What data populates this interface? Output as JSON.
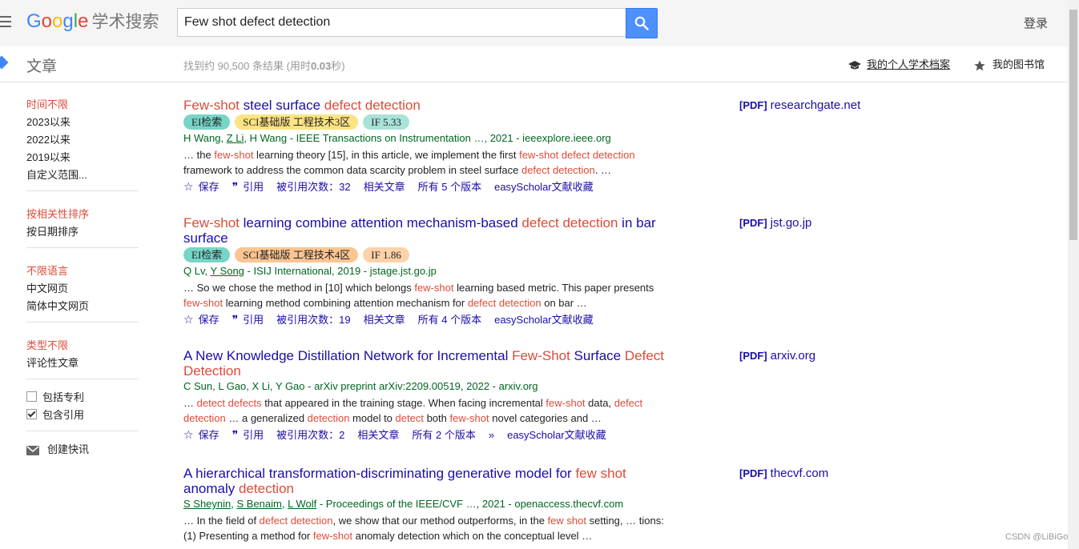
{
  "header": {
    "logo_google": [
      "G",
      "o",
      "o",
      "g",
      "l",
      "e"
    ],
    "logo_sub": "学术搜索",
    "search_value": "Few shot defect detection",
    "login": "登录"
  },
  "subheader": {
    "section": "文章",
    "stats_prefix": "找到约 90,500 条结果  (用时",
    "stats_time": "0.03",
    "stats_suffix": "秒)",
    "my_profile": "我的个人学术档案",
    "my_library": "我的图书馆"
  },
  "sidebar": {
    "time": [
      "时间不限",
      "2023以来",
      "2022以来",
      "2019以来",
      "自定义范围..."
    ],
    "sort": [
      "按相关性排序",
      "按日期排序"
    ],
    "lang": [
      "不限语言",
      "中文网页",
      "简体中文网页"
    ],
    "type": [
      "类型不限",
      "评论性文章"
    ],
    "include_patents": "包括专利",
    "include_citations": "包含引用",
    "create_alert": "创建快讯"
  },
  "results": [
    {
      "title": [
        [
          "Few-shot",
          true
        ],
        [
          " steel surface ",
          false
        ],
        [
          "defect detection",
          true
        ]
      ],
      "badges": [
        [
          "EI检索",
          "ei"
        ],
        [
          "SCI基础版 工程技术3区",
          "sci-yellow"
        ],
        [
          "IF 5.33",
          "if-teal"
        ]
      ],
      "authors": [
        [
          "H Wang",
          false
        ],
        [
          ", ",
          false
        ],
        [
          "Z Li",
          true
        ],
        [
          ", H Wang - IEEE Transactions on Instrumentation …, 2021 - ieeexplore.ieee.org",
          false
        ]
      ],
      "snippet": [
        [
          "… the ",
          false
        ],
        [
          "few-shot",
          true
        ],
        [
          " learning theory [15], in this article, we implement the first ",
          false
        ],
        [
          "few-shot defect detection",
          true
        ],
        [
          " framework to address the common data scarcity problem in steel surface ",
          false
        ],
        [
          "defect detection",
          true
        ],
        [
          ". …",
          false
        ]
      ],
      "save": "保存",
      "cite": "引用",
      "cited_by": "被引用次数：32",
      "related": "相关文章",
      "versions": "所有 5 个版本",
      "easyscholar": "easyScholar文献收藏",
      "pdf_tag": "[PDF]",
      "pdf_source": "researchgate.net"
    },
    {
      "title": [
        [
          "Few-shot",
          true
        ],
        [
          " learning combine attention mechanism-based ",
          false
        ],
        [
          "defect detection",
          true
        ],
        [
          " in bar surface",
          false
        ]
      ],
      "badges": [
        [
          "EI检索",
          "ei"
        ],
        [
          "SCI基础版 工程技术4区",
          "sci-orange"
        ],
        [
          "IF 1.86",
          "if-orange"
        ]
      ],
      "authors": [
        [
          "Q Lv",
          false
        ],
        [
          ", ",
          false
        ],
        [
          "Y Song",
          true
        ],
        [
          " - ISIJ International, 2019 - jstage.jst.go.jp",
          false
        ]
      ],
      "snippet": [
        [
          "… So we chose the method in [10] which belongs ",
          false
        ],
        [
          "few-shot",
          true
        ],
        [
          " learning based metric. This paper presents ",
          false
        ],
        [
          "few-shot",
          true
        ],
        [
          " learning method combining attention mechanism for ",
          false
        ],
        [
          "defect detection",
          true
        ],
        [
          " on bar …",
          false
        ]
      ],
      "save": "保存",
      "cite": "引用",
      "cited_by": "被引用次数：19",
      "related": "相关文章",
      "versions": "所有 4 个版本",
      "easyscholar": "easyScholar文献收藏",
      "pdf_tag": "[PDF]",
      "pdf_source": "jst.go.jp"
    },
    {
      "title": [
        [
          "A New Knowledge Distillation Network for Incremental ",
          false
        ],
        [
          "Few-Shot",
          true
        ],
        [
          " Surface ",
          false
        ],
        [
          "Defect Detection",
          true
        ]
      ],
      "badges": [],
      "authors": [
        [
          "C Sun, L Gao, X Li, Y Gao - arXiv preprint arXiv:2209.00519, 2022 - arxiv.org",
          false
        ]
      ],
      "snippet": [
        [
          "… ",
          false
        ],
        [
          "detect defects",
          true
        ],
        [
          " that appeared in the training stage. When facing incremental ",
          false
        ],
        [
          "few-shot",
          true
        ],
        [
          " data, ",
          false
        ],
        [
          "defect detection",
          true
        ],
        [
          " … a generalized ",
          false
        ],
        [
          "detection",
          true
        ],
        [
          " model to ",
          false
        ],
        [
          "detect",
          true
        ],
        [
          " both ",
          false
        ],
        [
          "few-shot",
          true
        ],
        [
          " novel categories and …",
          false
        ]
      ],
      "save": "保存",
      "cite": "引用",
      "cited_by": "被引用次数：2",
      "related": "相关文章",
      "versions": "所有 2 个版本",
      "easyscholar": "easyScholar文献收藏",
      "pdf_tag": "[PDF]",
      "pdf_source": "arxiv.org"
    },
    {
      "title": [
        [
          "A hierarchical transformation-discriminating generative model for ",
          false
        ],
        [
          "few shot",
          true
        ],
        [
          " anomaly ",
          false
        ],
        [
          "detection",
          true
        ]
      ],
      "badges": [],
      "authors": [
        [
          "S Sheynin",
          true
        ],
        [
          ", ",
          false
        ],
        [
          "S Benaim",
          true
        ],
        [
          ", ",
          false
        ],
        [
          "L Wolf",
          true
        ],
        [
          " - Proceedings of the IEEE/CVF …, 2021 - openaccess.thecvf.com",
          false
        ]
      ],
      "snippet": [
        [
          "… In the field of ",
          false
        ],
        [
          "defect detection",
          true
        ],
        [
          ", we show that our method outperforms, in the ",
          false
        ],
        [
          "few shot",
          true
        ],
        [
          " setting, … tions: (1) Presenting a method for ",
          false
        ],
        [
          "few-shot",
          true
        ],
        [
          " anomaly detection which on the conceptual level …",
          false
        ]
      ],
      "save": "",
      "cite": "",
      "cited_by": "",
      "related": "",
      "versions": "",
      "easyscholar": "",
      "pdf_tag": "[PDF]",
      "pdf_source": "thecvf.com"
    }
  ],
  "watermark": "CSDN @LiBiGo"
}
